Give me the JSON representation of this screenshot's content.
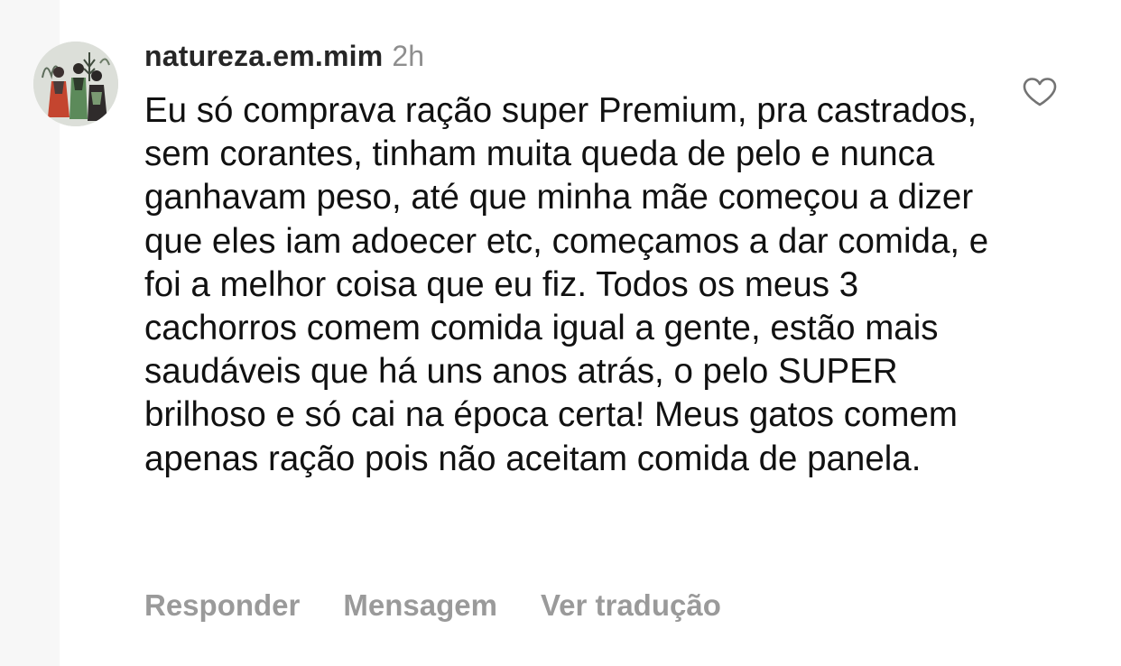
{
  "comment": {
    "username": "natureza.em.mim",
    "time": "2h",
    "text": "Eu só comprava ração super Premium, pra castrados, sem corantes, tinham muita queda de pelo e nunca ganhavam peso, até que minha mãe começou a dizer que eles iam adoecer etc, começamos a dar comida, e foi a melhor coisa que eu fiz. Todos os meus 3 cachorros comem comida igual a gente, estão mais saudáveis que há uns anos atrás, o pelo SUPER brilhoso e só cai na época certa! Meus gatos comem apenas ração pois não aceitam comida de panela.",
    "actions": {
      "reply": "Responder",
      "message": "Mensagem",
      "translate": "Ver tradução"
    },
    "icons": {
      "like": "heart-outline-icon",
      "avatar": "profile-picture"
    }
  },
  "colors": {
    "username": "#262626",
    "text": "#111111",
    "muted": "#8e8e8e",
    "action": "#9a9a9a"
  }
}
